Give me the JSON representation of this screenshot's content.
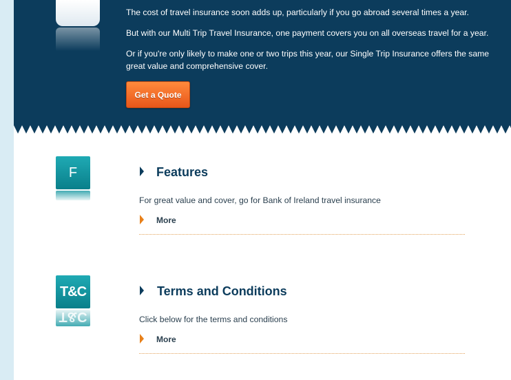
{
  "hero": {
    "paragraphs": [
      "The cost of travel insurance soon adds up, particularly if you go abroad several times a year.",
      "But with our Multi Trip Travel Insurance, one payment covers you on all overseas travel for a year.",
      "Or if you're only likely to make one or two trips this year, our Single Trip Insurance offers the same great value and comprehensive cover."
    ],
    "quote_button": "Get a Quote"
  },
  "sections": [
    {
      "icon_label": "F",
      "title": "Features",
      "description": "For great value and cover, go for Bank of Ireland travel insurance",
      "more_label": "More"
    },
    {
      "icon_label": "T&C",
      "title": "Terms and Conditions",
      "description": "Click below for the terms and conditions",
      "more_label": "More"
    }
  ],
  "colors": {
    "hero_background": "#0c3c5c",
    "page_background": "#d9ecf4",
    "button_orange": "#ff8a3c",
    "icon_teal": "#1faab4",
    "arrow_orange": "#e8801a"
  }
}
